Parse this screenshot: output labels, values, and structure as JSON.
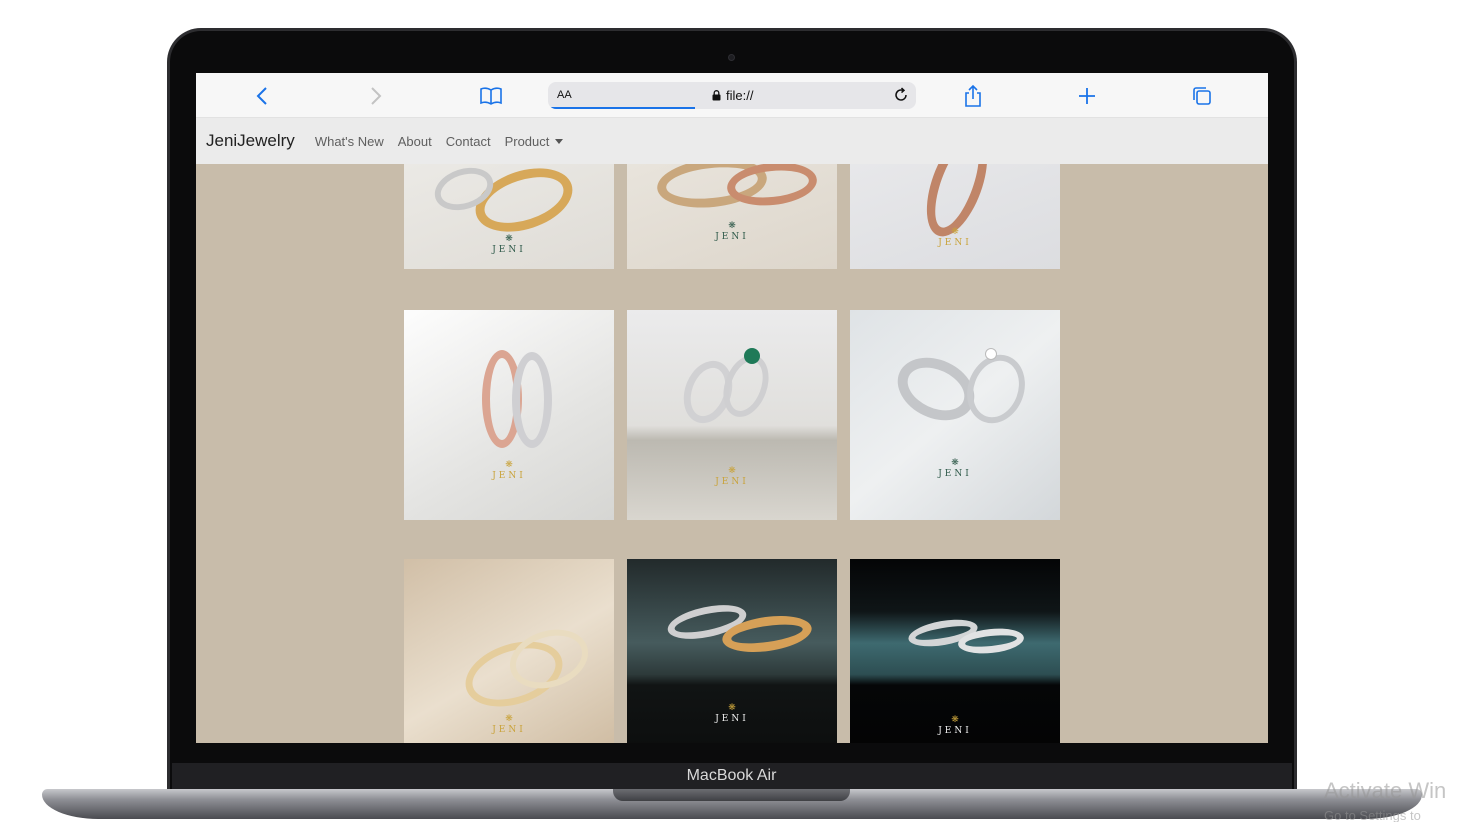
{
  "browser": {
    "reader_label": "AA",
    "url": "file://"
  },
  "site": {
    "brand": "JeniJewelry",
    "nav": [
      {
        "label": "What's New"
      },
      {
        "label": "About"
      },
      {
        "label": "Contact"
      },
      {
        "label": "Product"
      }
    ]
  },
  "gallery": {
    "logo_text": "JENI",
    "tiles": [
      {
        "id": 1,
        "description_icon": "gold-wedding-bands-photo"
      },
      {
        "id": 2,
        "description_icon": "mixed-gold-bands-photo"
      },
      {
        "id": 3,
        "description_icon": "rose-gold-band-photo"
      },
      {
        "id": 4,
        "description_icon": "rose-and-white-gold-bands-photo"
      },
      {
        "id": 5,
        "description_icon": "emerald-ring-pair-photo"
      },
      {
        "id": 6,
        "description_icon": "platinum-solitaire-pair-photo"
      },
      {
        "id": 7,
        "description_icon": "gold-bands-on-silk-photo"
      },
      {
        "id": 8,
        "description_icon": "gold-and-silver-bands-dark-photo"
      },
      {
        "id": 9,
        "description_icon": "silver-bands-teal-photo"
      }
    ]
  },
  "device": {
    "label": "MacBook Air"
  },
  "os_overlay": {
    "line1": "Activate Win",
    "line2": "Go to Settings to"
  },
  "colors": {
    "page_background": "#c8bcaa",
    "navbar": "#ebebeb",
    "accent_blue": "#1a73e8",
    "logo_gold": "#c9a33b",
    "logo_green": "#2f5a4a"
  }
}
